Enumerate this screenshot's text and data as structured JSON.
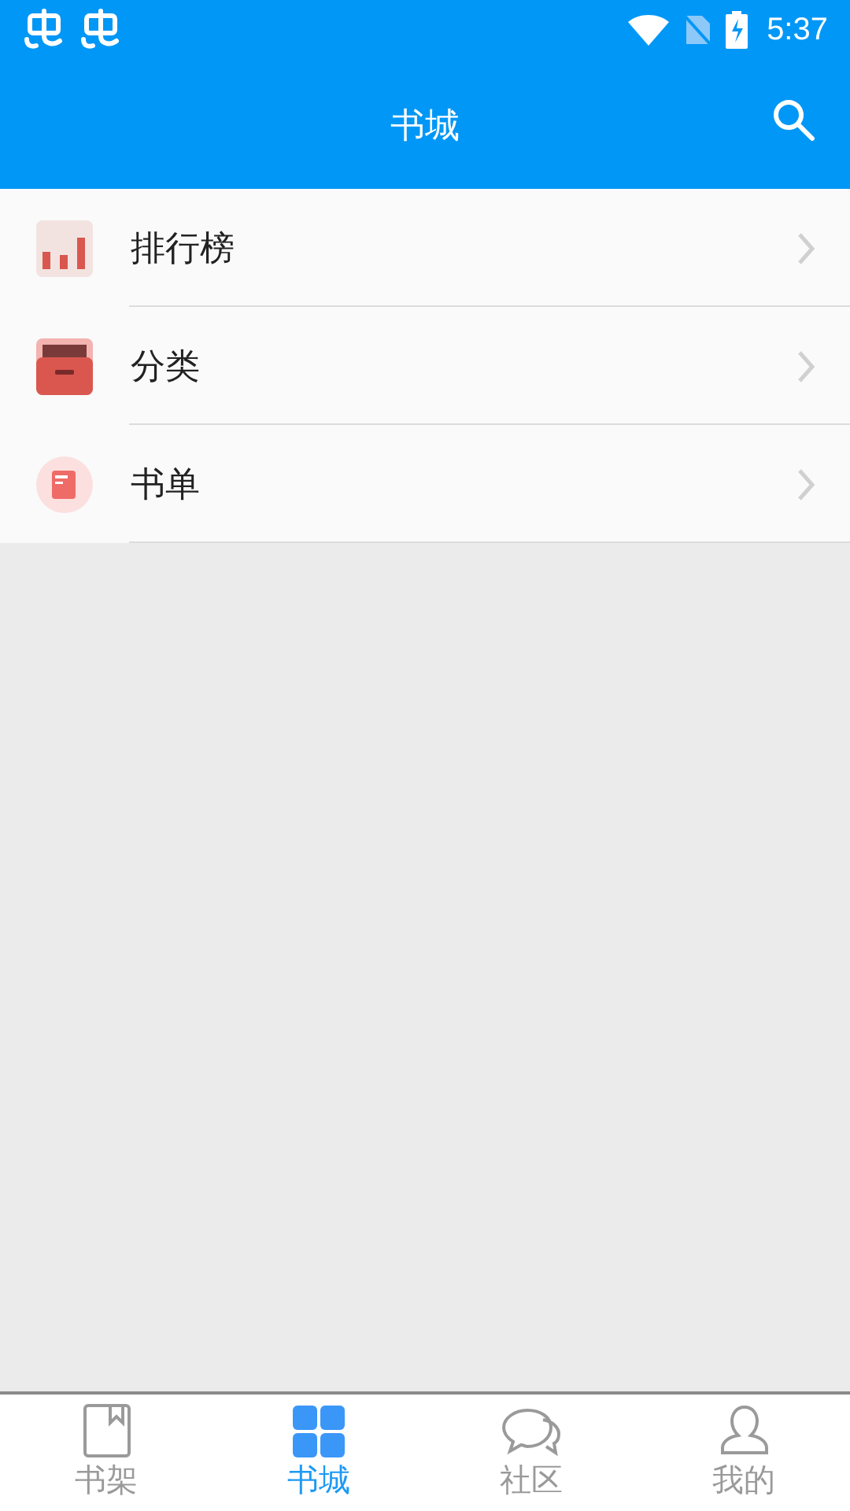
{
  "status_bar": {
    "time": "5:37"
  },
  "header": {
    "title": "书城"
  },
  "menu": [
    {
      "kind": "ranking",
      "label": "排行榜"
    },
    {
      "kind": "category",
      "label": "分类"
    },
    {
      "kind": "booklist",
      "label": "书单"
    }
  ],
  "bottom_nav": [
    {
      "kind": "shelf",
      "label": "书架",
      "selected": false
    },
    {
      "kind": "store",
      "label": "书城",
      "selected": true
    },
    {
      "kind": "community",
      "label": "社区",
      "selected": false
    },
    {
      "kind": "profile",
      "label": "我的",
      "selected": false
    }
  ]
}
